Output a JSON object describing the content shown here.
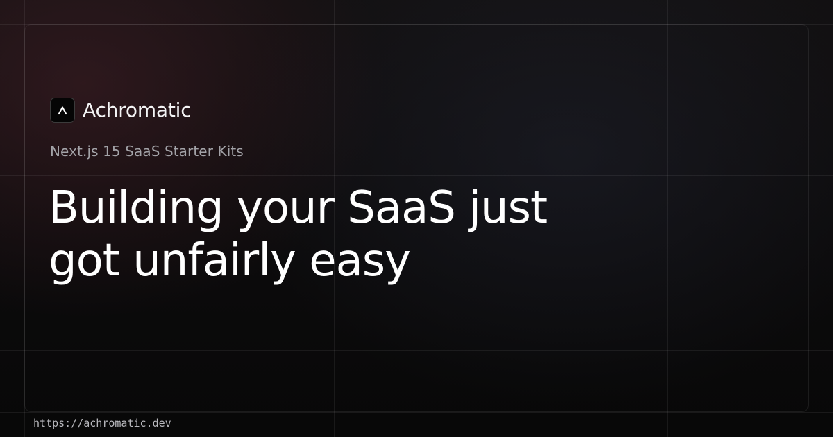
{
  "brand": {
    "name": "Achromatic",
    "logo_icon": "caret-up-icon"
  },
  "hero": {
    "tagline": "Next.js 15 SaaS Starter Kits",
    "headline_line1": "Building your SaaS just",
    "headline_line2": "got unfairly easy"
  },
  "footer": {
    "url": "https://achromatic.dev"
  },
  "colors": {
    "background": "#0b0b0c",
    "text_primary": "#ffffff",
    "text_secondary": "#a3a3a8",
    "accent_warm": "#462028"
  }
}
